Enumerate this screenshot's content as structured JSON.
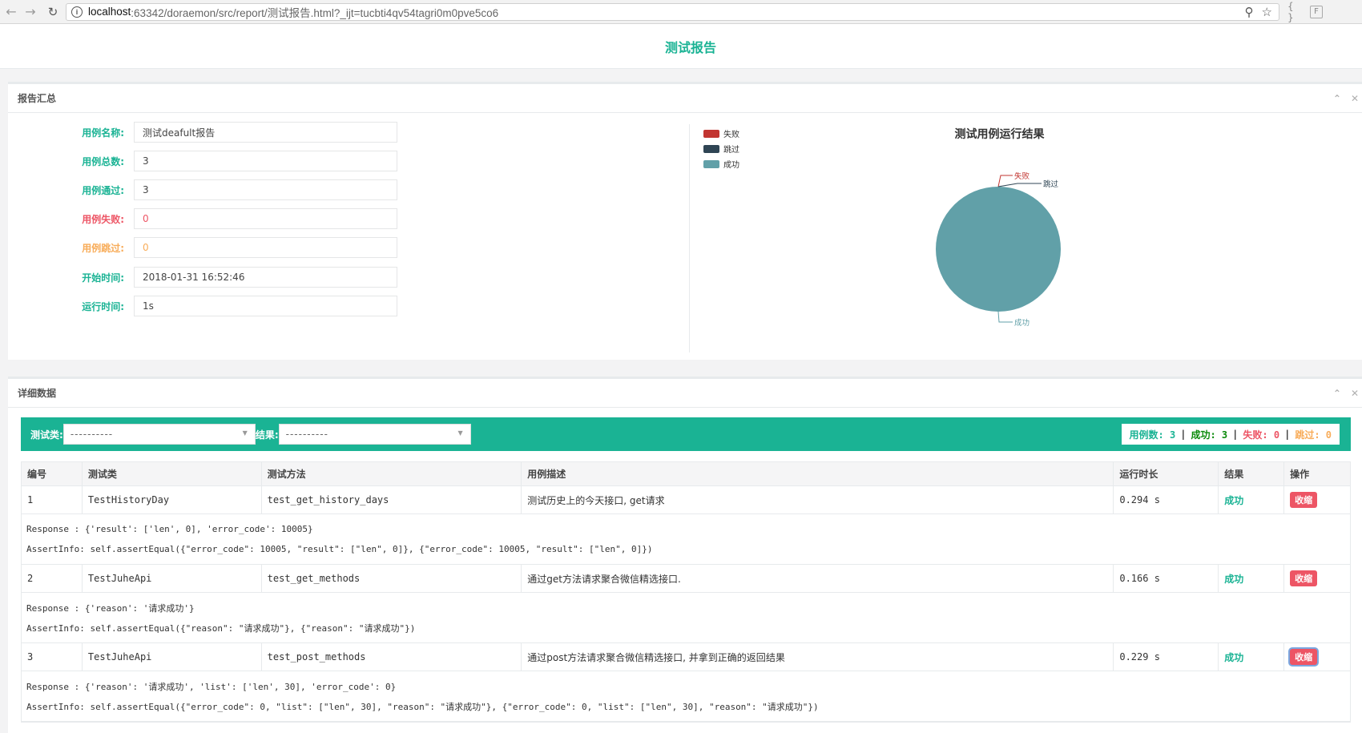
{
  "browser": {
    "url_host": "localhost",
    "url_path": ":63342/doraemon/src/report/测试报告.html?_ijt=tucbti4qv54tagri0m0pve5co6"
  },
  "page": {
    "title": "测试报告"
  },
  "summary": {
    "panel_title": "报告汇总",
    "fields": [
      {
        "label": "用例名称:",
        "value": "测试deafult报告",
        "color": "#1ab394",
        "value_color": "#444444"
      },
      {
        "label": "用例总数:",
        "value": "3",
        "color": "#1ab394",
        "value_color": "#444444"
      },
      {
        "label": "用例通过:",
        "value": "3",
        "color": "#1ab394",
        "value_color": "#444444"
      },
      {
        "label": "用例失败:",
        "value": "0",
        "color": "#ed5565",
        "value_color": "#ed5565"
      },
      {
        "label": "用例跳过:",
        "value": "0",
        "color": "#f8ac59",
        "value_color": "#f8ac59"
      },
      {
        "label": "开始时间:",
        "value": "2018-01-31 16:52:46",
        "color": "#1ab394",
        "value_color": "#444444"
      },
      {
        "label": "运行时间:",
        "value": "1s",
        "color": "#1ab394",
        "value_color": "#444444"
      }
    ]
  },
  "chart_data": {
    "type": "pie",
    "title": "测试用例运行结果",
    "legend_position": "top-left",
    "series": [
      {
        "name": "失败",
        "value": 0,
        "color": "#c23531"
      },
      {
        "name": "跳过",
        "value": 0,
        "color": "#2f4554"
      },
      {
        "name": "成功",
        "value": 3,
        "color": "#61a0a8"
      }
    ]
  },
  "detail": {
    "panel_title": "详细数据",
    "filter": {
      "class_label": "测试类:",
      "class_value": "----------",
      "result_label": "结果:",
      "result_value": "----------"
    },
    "stats": {
      "total": "用例数: 3",
      "pass": "成功: 3",
      "fail": "失败: 0",
      "skip": "跳过: 0",
      "sep": "|"
    },
    "columns": [
      "编号",
      "测试类",
      "测试方法",
      "用例描述",
      "运行时长",
      "结果",
      "操作"
    ],
    "rows": [
      {
        "id": "1",
        "cls": "TestHistoryDay",
        "method": "test_get_history_days",
        "desc": "测试历史上的今天接口, get请求",
        "duration": "0.294 s",
        "result": "成功",
        "action": "收缩",
        "response": "Response : {'result': ['len', 0], 'error_code': 10005}",
        "assert": "AssertInfo: self.assertEqual({\"error_code\": 10005, \"result\": [\"len\", 0]}, {\"error_code\": 10005, \"result\": [\"len\", 0]})"
      },
      {
        "id": "2",
        "cls": "TestJuheApi",
        "method": "test_get_methods",
        "desc": "通过get方法请求聚合微信精选接口.",
        "duration": "0.166 s",
        "result": "成功",
        "action": "收缩",
        "response": "Response : {'reason': '请求成功'}",
        "assert": "AssertInfo: self.assertEqual({\"reason\": \"请求成功\"}, {\"reason\": \"请求成功\"})"
      },
      {
        "id": "3",
        "cls": "TestJuheApi",
        "method": "test_post_methods",
        "desc": "通过post方法请求聚合微信精选接口, 并拿到正确的返回结果",
        "duration": "0.229 s",
        "result": "成功",
        "action": "收缩",
        "response": "Response : {'reason': '请求成功', 'list': ['len', 30], 'error_code': 0}",
        "assert": "AssertInfo: self.assertEqual({\"error_code\": 0, \"list\": [\"len\", 30], \"reason\": \"请求成功\"}, {\"error_code\": 0, \"list\": [\"len\", 30], \"reason\": \"请求成功\"})"
      }
    ]
  }
}
